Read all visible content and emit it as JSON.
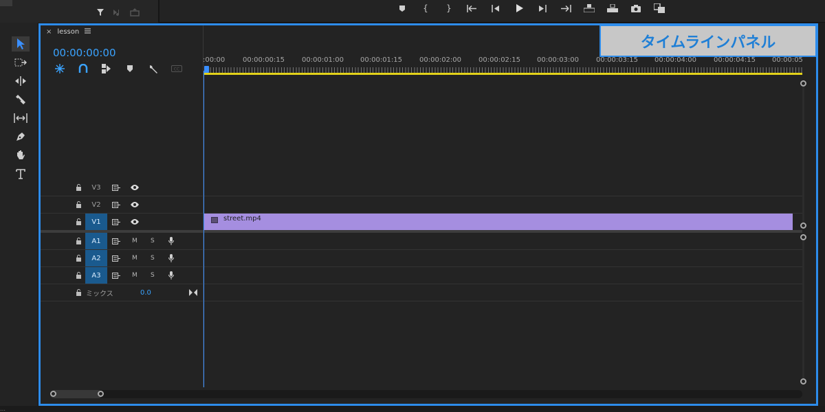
{
  "sequence": {
    "tab_label": "lesson",
    "timecode": "00:00:00:00"
  },
  "ruler": {
    "labels": [
      ":00:00",
      "00:00:00:15",
      "00:00:01:00",
      "00:00:01:15",
      "00:00:02:00",
      "00:00:02:15",
      "00:00:03:00",
      "00:00:03:15",
      "00:00:04:00",
      "00:00:04:15",
      "00:00:05"
    ]
  },
  "tracks": {
    "video": [
      {
        "name": "V3",
        "targeted": false
      },
      {
        "name": "V2",
        "targeted": false
      },
      {
        "name": "V1",
        "targeted": true
      }
    ],
    "audio": [
      {
        "name": "A1",
        "targeted": true
      },
      {
        "name": "A2",
        "targeted": true
      },
      {
        "name": "A3",
        "targeted": true
      }
    ],
    "mute_label": "M",
    "solo_label": "S",
    "mix": {
      "label": "ミックス",
      "value": "0.0"
    }
  },
  "clip": {
    "name": "street.mp4",
    "color": "#a58ee0"
  },
  "callout": {
    "text": "タイムラインパネル"
  },
  "colors": {
    "accent": "#2d8ceb",
    "timecode": "#3aa3ff",
    "workarea": "#e3d21a"
  },
  "icons": {
    "tools": [
      "selection-tool-icon",
      "track-select-forward-icon",
      "ripple-edit-icon",
      "razor-icon",
      "slip-icon",
      "pen-icon",
      "hand-icon",
      "type-icon"
    ],
    "transport": [
      "add-marker-icon",
      "mark-in-icon",
      "mark-out-icon",
      "go-to-in-icon",
      "step-back-icon",
      "play-icon",
      "step-forward-icon",
      "go-to-out-icon",
      "lift-icon",
      "extract-icon",
      "export-frame-icon",
      "comparison-view-icon"
    ]
  },
  "footer_text": "…"
}
